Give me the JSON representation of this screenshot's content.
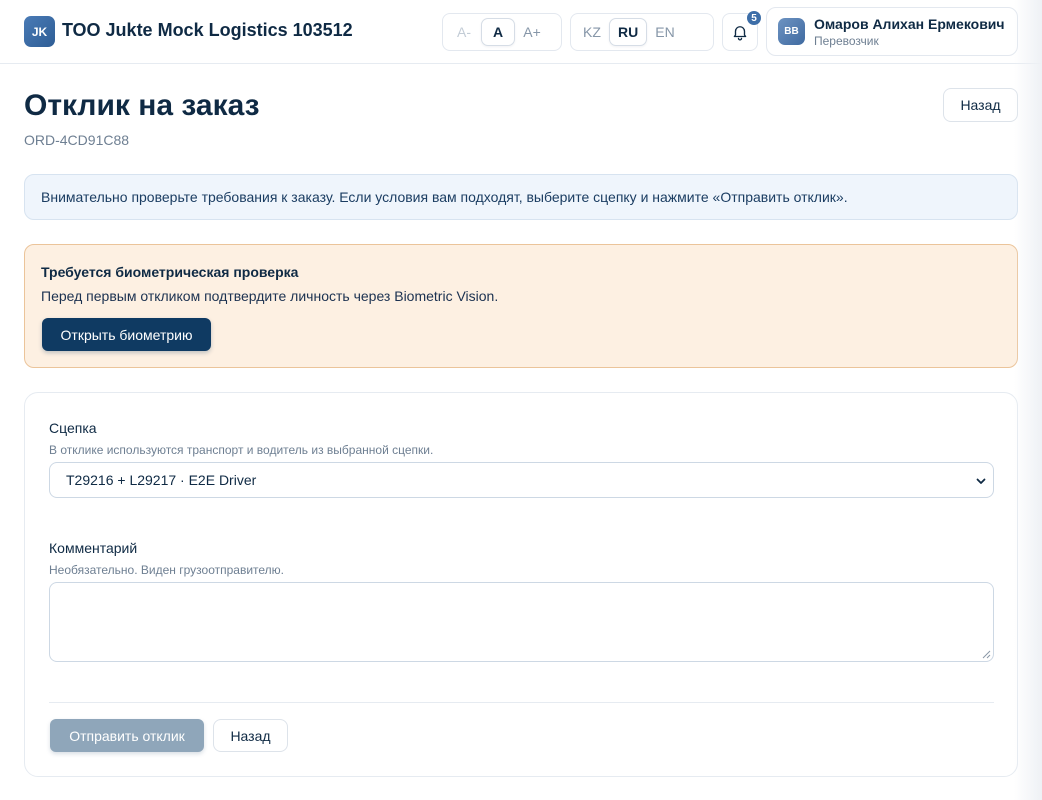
{
  "header": {
    "logo_initials": "JK",
    "company_name": "ТОО Jukte Mock Logistics 103512",
    "font_size_options": [
      "A-",
      "A",
      "A+"
    ],
    "font_size_selected": "A",
    "language_options": [
      "KZ",
      "RU",
      "EN"
    ],
    "language_selected": "RU",
    "notifications_count": "5",
    "user": {
      "initials": "BB",
      "name": "Омаров Алихан Ермекович",
      "role": "Перевозчик"
    }
  },
  "page": {
    "title": "Отклик на заказ",
    "order_id": "ORD-4CD91C88",
    "back_label": "Назад"
  },
  "info_banner": {
    "text": "Внимательно проверьте требования к заказу. Если условия вам подходят, выберите сцепку и нажмите «Отправить отклик»."
  },
  "biometric": {
    "title": "Требуется биометрическая проверка",
    "text": "Перед первым откликом подтвердите личность через Biometric Vision.",
    "button_label": "Открыть биометрию"
  },
  "form": {
    "coupling": {
      "label": "Сцепка",
      "hint": "В отклике используются транспорт и водитель из выбранной сцепки.",
      "selected_value": "T29216 + L29217 · E2E Driver"
    },
    "comment": {
      "label": "Комментарий",
      "hint": "Необязательно. Виден грузоотправителю.",
      "value": ""
    },
    "submit_label": "Отправить отклик",
    "back_label": "Назад"
  },
  "colors": {
    "primary": "#0f3a62",
    "accent": "#3d6ea8",
    "info_bg": "#eff5fc",
    "warning_bg": "#fdf0e2",
    "warning_border": "#ebc49a",
    "disabled_button": "#8fa6ba"
  },
  "icons": {
    "notifications": "bell-icon",
    "select": "chevron-down-icon",
    "resize": "resize-grip-icon"
  }
}
